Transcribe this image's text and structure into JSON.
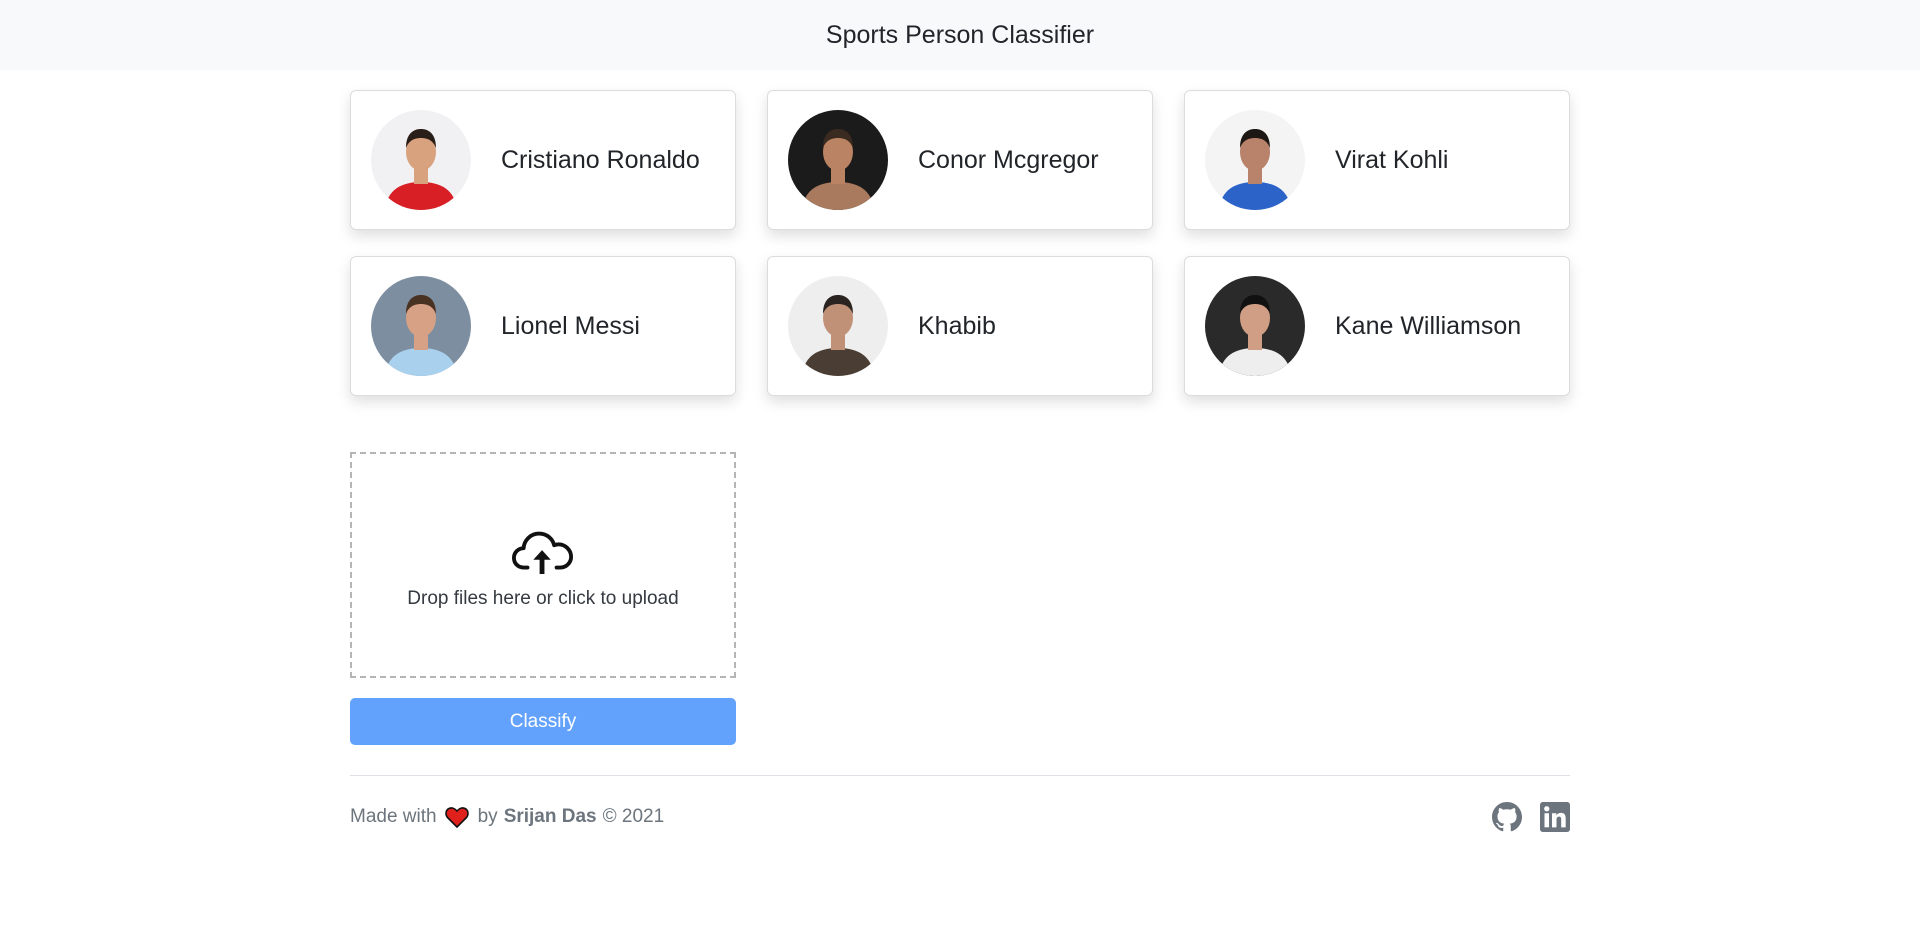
{
  "header": {
    "title": "Sports Person Classifier"
  },
  "players": [
    {
      "name": "Cristiano Ronaldo",
      "photo": "ronaldo-photo",
      "bg": "#f1f1f3",
      "skin": "#d9a27e",
      "hair": "#2a1e18",
      "shirt": "#d81f26"
    },
    {
      "name": "Conor Mcgregor",
      "photo": "mcgregor-photo",
      "bg": "#1b1b1b",
      "skin": "#b98364",
      "hair": "#3a2a20",
      "shirt": "#a97a5e"
    },
    {
      "name": "Virat Kohli",
      "photo": "kohli-photo",
      "bg": "#f4f4f4",
      "skin": "#b9826a",
      "hair": "#1e1814",
      "shirt": "#2b63c9"
    },
    {
      "name": "Lionel Messi",
      "photo": "messi-photo",
      "bg": "#7d8ea0",
      "skin": "#d6a184",
      "hair": "#4a3222",
      "shirt": "#a9d1ee"
    },
    {
      "name": "Khabib",
      "photo": "khabib-photo",
      "bg": "#eeeeee",
      "skin": "#c09177",
      "hair": "#2a2320",
      "shirt": "#4a3d33"
    },
    {
      "name": "Kane Williamson",
      "photo": "williamson-photo",
      "bg": "#2a2a2a",
      "skin": "#cf9e84",
      "hair": "#111111",
      "shirt": "#eeeeee"
    }
  ],
  "upload": {
    "text": "Drop files here or click to upload",
    "icon": "cloud-upload-icon"
  },
  "classify": {
    "label": "Classify"
  },
  "footer": {
    "made_with": "Made with",
    "by": "by",
    "author": "Srijan Das",
    "copyright": "© 2021",
    "icons": [
      "heart-icon",
      "github-icon",
      "linkedin-icon"
    ]
  },
  "colors": {
    "accent": "#62a2fd",
    "navbar_bg": "#f8f9fa",
    "heart": "#e0201c"
  }
}
